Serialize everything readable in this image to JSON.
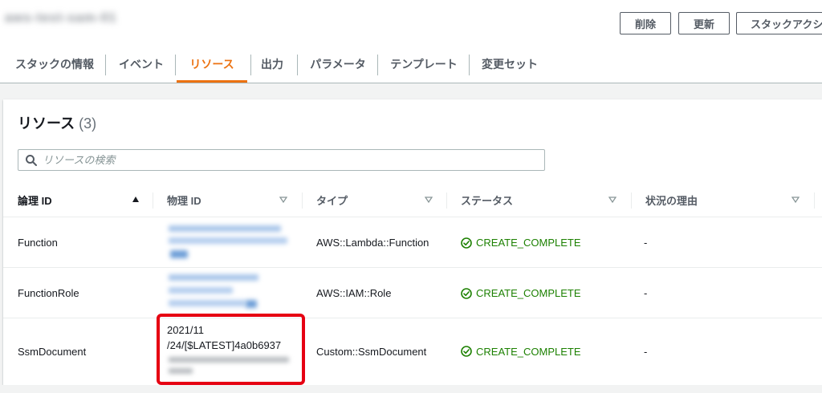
{
  "header": {
    "stack_title": "aws-test-sam-01",
    "buttons": {
      "delete": "削除",
      "update": "更新",
      "stack_actions": "スタックアクション"
    }
  },
  "tabs": [
    {
      "label": "スタックの情報",
      "active": false
    },
    {
      "label": "イベント",
      "active": false
    },
    {
      "label": "リソース",
      "active": true
    },
    {
      "label": "出力",
      "active": false
    },
    {
      "label": "パラメータ",
      "active": false
    },
    {
      "label": "テンプレート",
      "active": false
    },
    {
      "label": "変更セット",
      "active": false
    }
  ],
  "resources": {
    "title": "リソース",
    "count": "(3)",
    "search": {
      "placeholder": "リソースの検索",
      "value": ""
    },
    "columns": [
      {
        "label": "論理 ID",
        "sort": "ascending"
      },
      {
        "label": "物理 ID",
        "sort": "none"
      },
      {
        "label": "タイプ",
        "sort": "none"
      },
      {
        "label": "ステータス",
        "sort": "none"
      },
      {
        "label": "状況の理由",
        "sort": "none"
      }
    ],
    "rows": [
      {
        "logical_id": "Function",
        "physical_id_lines": [],
        "type": "AWS::Lambda::Function",
        "status": "CREATE_COMPLETE",
        "reason": "-"
      },
      {
        "logical_id": "FunctionRole",
        "physical_id_lines": [],
        "type": "AWS::IAM::Role",
        "status": "CREATE_COMPLETE",
        "reason": "-"
      },
      {
        "logical_id": "SsmDocument",
        "physical_id_lines": [
          "2021/11",
          "/24/[$LATEST]4a0b6937"
        ],
        "type": "Custom::SsmDocument",
        "status": "CREATE_COMPLETE",
        "reason": "-"
      }
    ]
  },
  "colors": {
    "accent_orange": "#ec7211",
    "status_green": "#1d8102",
    "highlight_red": "#e60012",
    "link_blue_blurred": "#9bbde8"
  },
  "icons": {
    "search": "search-icon",
    "sort_asc": "sort-ascending-icon",
    "sort_none": "sort-descending-caret-icon",
    "status": "check-circle-icon"
  }
}
